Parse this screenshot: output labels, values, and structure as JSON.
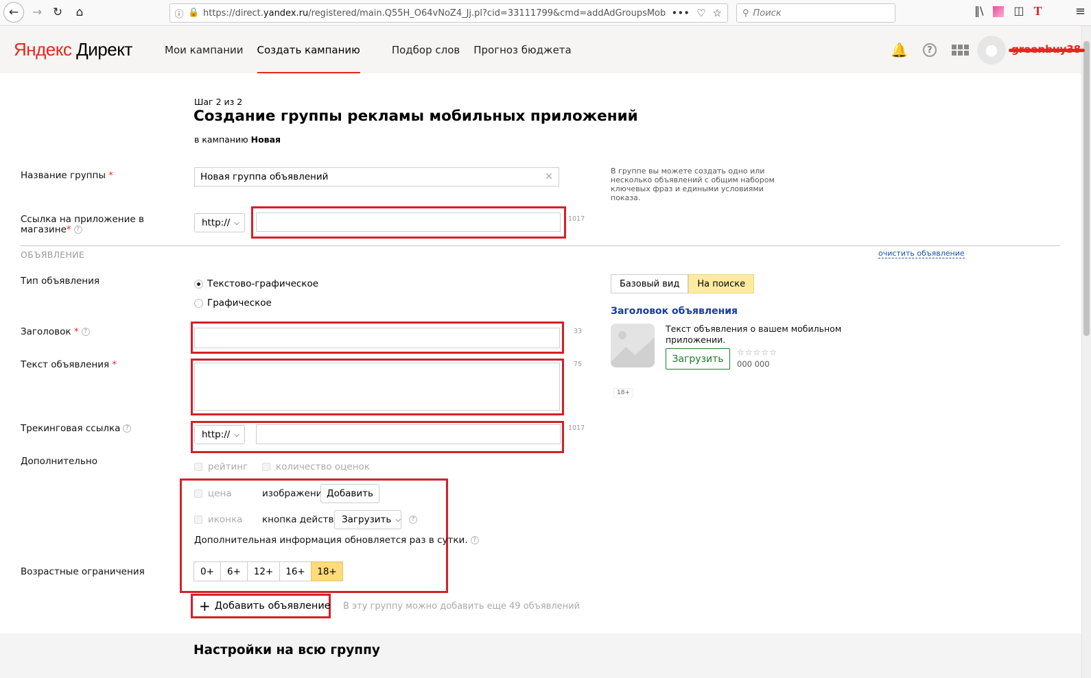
{
  "browser": {
    "url_prefix": "https://direct.",
    "url_host": "yandex.ru",
    "url_rest": "/registered/main.Q55H_O64vNoZ4_Jj.pl?cid=33111799&cmd=addAdGroupsMob",
    "search_placeholder": "Поиск",
    "more_label": "•••"
  },
  "header": {
    "logo_ya": "Яндекс",
    "logo_rest": " Директ",
    "menu": [
      "Мои кампании",
      "Создать кампанию",
      "Подбор слов",
      "Прогноз бюджета"
    ],
    "active_menu": "Создать кампанию",
    "username": "greenbuy38"
  },
  "form": {
    "step": "Шаг 2 из 2",
    "title": "Создание группы рекламы мобильных приложений",
    "campaign_prefix": "в кампанию ",
    "campaign_name": "Новая",
    "group_name_label": "Название группы",
    "group_name_value": "Новая группа объявлений",
    "group_hint": "В группе вы можете создать одно или несколько объявлений с общим набором ключевых фраз и едиными условиями показа.",
    "app_link_label_1": "Ссылка на приложение в",
    "app_link_label_2": "магазине",
    "protocol": "http://",
    "app_link_counter": "1017",
    "section_title": "ОБЪЯВЛЕНИЕ",
    "clear_ad": "очистить объявление",
    "ad_type_label": "Тип объявления",
    "ad_types": [
      "Текстово-графическое",
      "Графическое"
    ],
    "headline_label": "Заголовок",
    "headline_counter": "33",
    "text_label": "Текст объявления",
    "text_counter": "75",
    "tracking_label": "Трекинговая ссылка",
    "tracking_counter": "1017",
    "extra_label": "Дополнительно",
    "extra_rating": "рейтинг",
    "extra_reviews": "количество оценок",
    "extra_price": "цена",
    "extra_image": "изображение",
    "add_button": "Добавить",
    "extra_icon": "иконка",
    "action_button_label": "кнопка действия",
    "action_button_value": "Загрузить",
    "extra_note": "Дополнительная информация обновляется раз в сутки.",
    "age_label": "Возрастные ограничения",
    "ages": [
      "0+",
      "6+",
      "12+",
      "16+",
      "18+"
    ],
    "age_selected": "18+",
    "add_ad_button": "Добавить объявление",
    "add_ad_note": "В эту группу можно добавить еще 49 объявлений",
    "group_settings_title": "Настройки на всю группу"
  },
  "preview": {
    "tabs": [
      "Базовый вид",
      "На поиске"
    ],
    "active_tab": "На поиске",
    "ad_title": "Заголовок объявления",
    "ad_text": "Текст объявления о вашем мобильном приложении.",
    "load_button": "Загрузить",
    "stars": "☆☆☆☆☆",
    "downloads": "000 000",
    "age_badge": "18+"
  },
  "colors": {
    "accent_red": "#e8261b",
    "highlight_red_box": "#d42027",
    "selected_yellow": "#ffdb7a",
    "link_blue": "#1a52a8"
  }
}
